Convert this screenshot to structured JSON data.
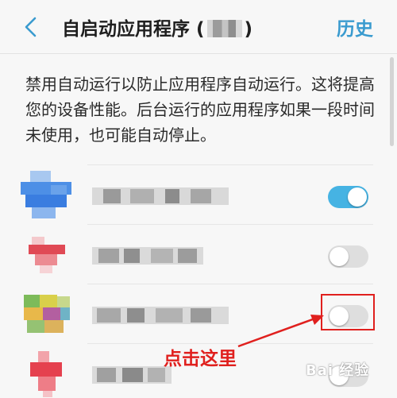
{
  "header": {
    "title": "自启动应用程序 (",
    "title_close": ")",
    "history_label": "历史"
  },
  "description": "禁用自动运行以防止应用程序自动运行。这将提高您的设备性能。后台运行的应用程序如果一段时间未使用，也可能自动停止。",
  "apps": [
    {
      "enabled": true
    },
    {
      "enabled": false
    },
    {
      "enabled": false
    },
    {
      "enabled": false
    }
  ],
  "annotation": {
    "label": "点击这里",
    "color": "#e0201e"
  },
  "watermark": "Bai 经验",
  "colors": {
    "accent": "#46b3e3",
    "history_text": "#3a9bcf",
    "annotation": "#e0201e"
  }
}
